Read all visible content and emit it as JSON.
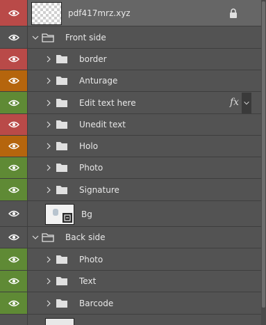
{
  "layers": [
    {
      "name": "pdf417mrz.xyz",
      "eye_color": "#b94a48",
      "locked": true
    },
    {
      "name": "Front side",
      "eye_color": "#535353",
      "expanded": true
    },
    {
      "name": "border",
      "eye_color": "#b94a48"
    },
    {
      "name": "Anturage",
      "eye_color": "#b5650d"
    },
    {
      "name": "Edit text here",
      "eye_color": "#5f8a35",
      "fx": "fx"
    },
    {
      "name": "Unedit text",
      "eye_color": "#b94a48"
    },
    {
      "name": "Holo",
      "eye_color": "#b5650d"
    },
    {
      "name": "Photo",
      "eye_color": "#5f8a35"
    },
    {
      "name": "Signature",
      "eye_color": "#5f8a35"
    },
    {
      "name": "Bg",
      "eye_color": "#535353"
    },
    {
      "name": "Back side",
      "eye_color": "#535353",
      "expanded": true
    },
    {
      "name": "Photo",
      "eye_color": "#5f8a35"
    },
    {
      "name": "Text",
      "eye_color": "#5f8a35"
    },
    {
      "name": "Barcode",
      "eye_color": "#5f8a35"
    }
  ],
  "icons": {
    "visibility": "eye-icon",
    "lock": "lock-icon",
    "folder": "folder-icon",
    "collapsed": "chevron-right-icon",
    "expanded": "chevron-down-icon",
    "effects": "fx-icon"
  },
  "colors": {
    "panel_bg": "#535353",
    "selected_row_bg": "#666666",
    "visibility_red": "#b94a48",
    "visibility_orange": "#b5650d",
    "visibility_green": "#5f8a35"
  }
}
